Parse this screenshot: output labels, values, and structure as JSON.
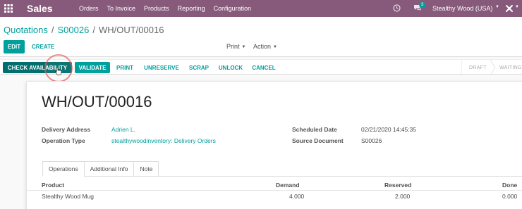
{
  "navbar": {
    "app_name": "Sales",
    "menu": [
      "Orders",
      "To Invoice",
      "Products",
      "Reporting",
      "Configuration"
    ],
    "chat_badge": "3",
    "company": "Stealthy Wood (USA)",
    "bg_color": "#875a7b",
    "icons": [
      "apps-grid-icon",
      "clock-icon",
      "chat-icon",
      "debug-icon"
    ]
  },
  "breadcrumb": {
    "items": [
      "Quotations",
      "S00026"
    ],
    "separator": "/",
    "current": "WH/OUT/00016"
  },
  "control": {
    "edit_label": "EDIT",
    "create_label": "CREATE",
    "print_label": "Print",
    "action_label": "Action"
  },
  "statusbar": {
    "buttons": [
      "CHECK AVAILABILITY",
      "VALIDATE",
      "PRINT",
      "UNRESERVE",
      "SCRAP",
      "UNLOCK",
      "CANCEL"
    ],
    "stages": [
      "DRAFT",
      "WAITING"
    ]
  },
  "form": {
    "title": "WH/OUT/00016",
    "delivery_address_label": "Delivery Address",
    "delivery_address_value": "Adrien L.",
    "operation_type_label": "Operation Type",
    "operation_type_value": "stealthywoodinventory: Delivery Orders",
    "scheduled_date_label": "Scheduled Date",
    "scheduled_date_value": "02/21/2020 14:45:35",
    "source_document_label": "Source Document",
    "source_document_value": "S00026"
  },
  "tabs": [
    "Operations",
    "Additional Info",
    "Note"
  ],
  "table": {
    "columns": [
      "Product",
      "Demand",
      "Reserved",
      "Done"
    ],
    "rows": [
      {
        "product": "Stealthy Wood Mug",
        "demand": "4.000",
        "reserved": "2.000",
        "done": "0.000"
      }
    ]
  },
  "colors": {
    "accent": "#00a09d",
    "brand": "#875a7b"
  }
}
